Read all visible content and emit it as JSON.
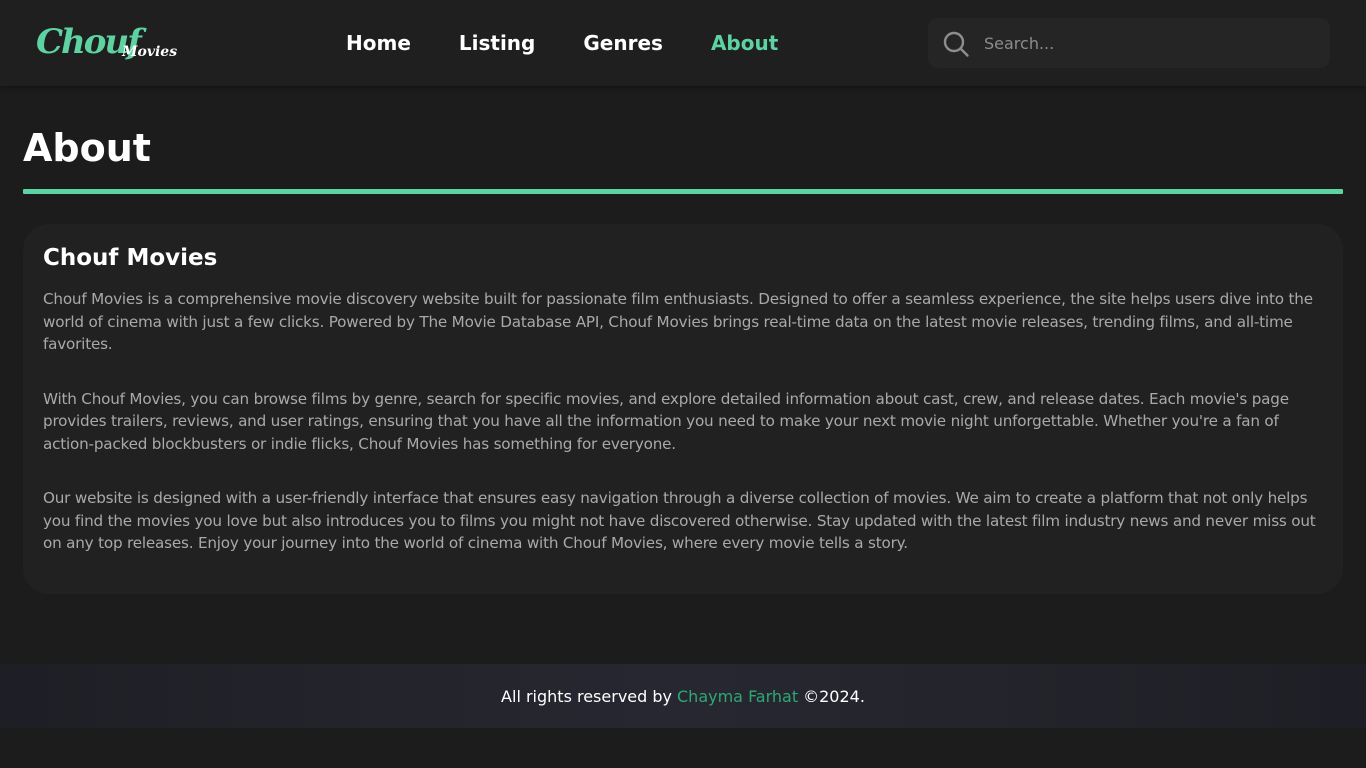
{
  "brand": {
    "logo_script": "Chouf",
    "logo_sub": "Movies",
    "accent_color": "#5ed3a2"
  },
  "nav": {
    "items": [
      {
        "label": "Home",
        "active": false
      },
      {
        "label": "Listing",
        "active": false
      },
      {
        "label": "Genres",
        "active": false
      },
      {
        "label": "About",
        "active": true
      }
    ]
  },
  "search": {
    "placeholder": "Search...",
    "value": "",
    "icon": "search-icon"
  },
  "main": {
    "page_title": "About",
    "card": {
      "heading": "Chouf Movies",
      "paragraphs": [
        "Chouf Movies is a comprehensive movie discovery website built for passionate film enthusiasts. Designed to offer a seamless experience, the site helps users dive into the world of cinema with just a few clicks. Powered by The Movie Database API, Chouf Movies brings real-time data on the latest movie releases, trending films, and all-time favorites.",
        "With Chouf Movies, you can browse films by genre, search for specific movies, and explore detailed information about cast, crew, and release dates. Each movie's page provides trailers, reviews, and user ratings, ensuring that you have all the information you need to make your next movie night unforgettable. Whether you're a fan of action-packed blockbusters or indie flicks, Chouf Movies has something for everyone.",
        "Our website is designed with a user-friendly interface that ensures easy navigation through a diverse collection of movies. We aim to create a platform that not only helps you find the movies you love but also introduces you to films you might not have discovered otherwise. Stay updated with the latest film industry news and never miss out on any top releases. Enjoy your journey into the world of cinema with Chouf Movies, where every movie tells a story."
      ]
    }
  },
  "footer": {
    "prefix": "All rights reserved by",
    "author": "Chayma Farhat",
    "suffix": "©2024."
  }
}
